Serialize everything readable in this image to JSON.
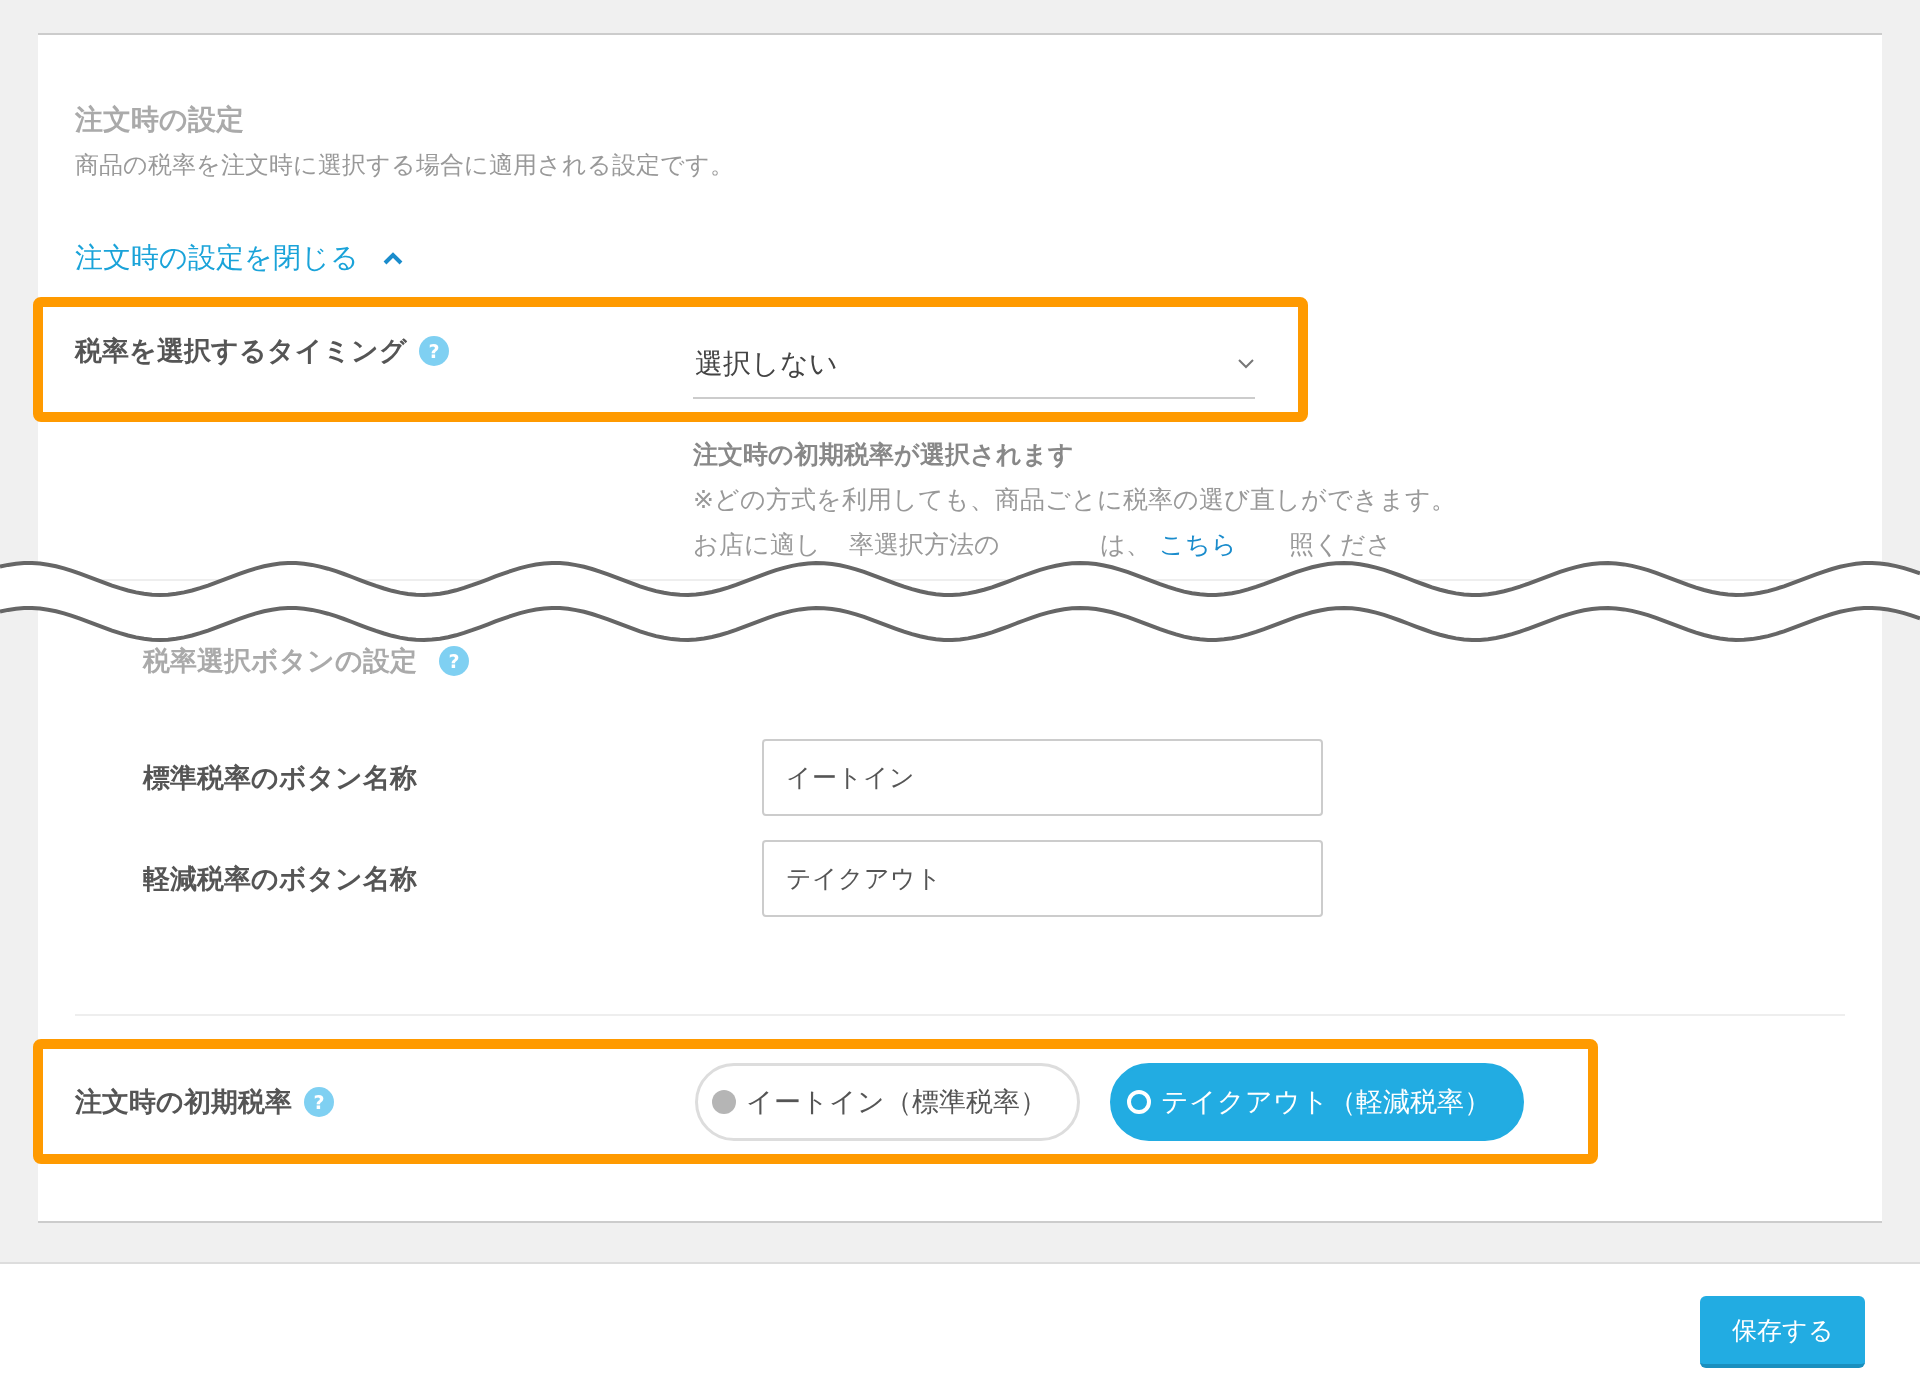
{
  "section": {
    "title": "注文時の設定",
    "description": "商品の税率を注文時に選択する場合に適用される設定です。",
    "toggle_link": "注文時の設定を閉じる"
  },
  "timing": {
    "label": "税率を選択するタイミング",
    "help": "?",
    "select_value": "選択しない",
    "highlighted": true
  },
  "notes": {
    "heading": "注文時の初期税率が選択されます",
    "line": "※どの方式を利用しても、商品ごとに税率の選び直しができます。",
    "partial_line": [
      {
        "kind": "text",
        "text": "お店に適し"
      },
      {
        "kind": "text",
        "text": "率選択方法の"
      },
      {
        "kind": "text",
        "text": "は、"
      },
      {
        "kind": "link",
        "text": "こちら"
      },
      {
        "kind": "text",
        "text": "照くださ"
      }
    ]
  },
  "button_settings": {
    "title": "税率選択ボタンの設定",
    "help": "?",
    "fields": [
      {
        "label": "標準税率のボタン名称",
        "value": "イートイン"
      },
      {
        "label": "軽減税率のボタン名称",
        "value": "テイクアウト"
      }
    ]
  },
  "initial_rate": {
    "label": "注文時の初期税率",
    "help": "?",
    "highlighted": true,
    "options": [
      {
        "label": "イートイン（標準税率）",
        "selected": false
      },
      {
        "label": "テイクアウト（軽減税率）",
        "selected": true
      }
    ]
  },
  "save_button": "保存する"
}
